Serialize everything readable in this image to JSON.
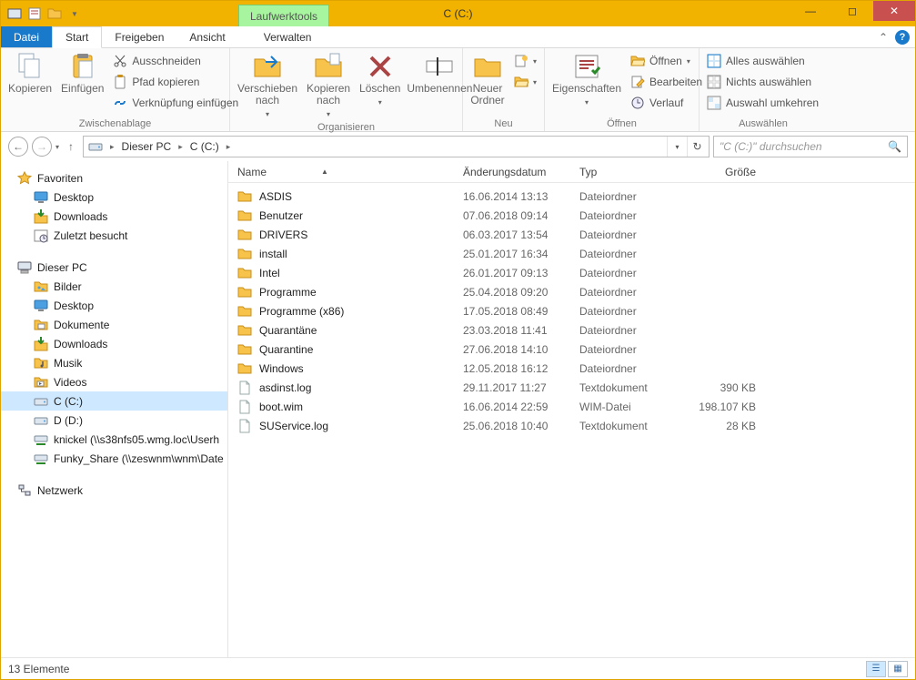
{
  "window": {
    "title": "C (C:)",
    "title_tab": "Laufwerktools"
  },
  "tabs": {
    "datei": "Datei",
    "start": "Start",
    "freigeben": "Freigeben",
    "ansicht": "Ansicht",
    "verwalten": "Verwalten"
  },
  "ribbon": {
    "zwischenablage": {
      "label": "Zwischenablage",
      "kopieren": "Kopieren",
      "einfuegen": "Einfügen",
      "ausschneiden": "Ausschneiden",
      "pfad_kopieren": "Pfad kopieren",
      "verknuepfung": "Verknüpfung einfügen"
    },
    "organisieren": {
      "label": "Organisieren",
      "verschieben": "Verschieben nach",
      "kopieren_nach": "Kopieren nach",
      "loeschen": "Löschen",
      "umbenennen": "Umbenennen"
    },
    "neu": {
      "label": "Neu",
      "neuer_ordner": "Neuer Ordner"
    },
    "oeffnen": {
      "label": "Öffnen",
      "eigenschaften": "Eigenschaften",
      "oeffnen": "Öffnen",
      "bearbeiten": "Bearbeiten",
      "verlauf": "Verlauf"
    },
    "auswaehlen": {
      "label": "Auswählen",
      "alles": "Alles auswählen",
      "nichts": "Nichts auswählen",
      "umkehren": "Auswahl umkehren"
    }
  },
  "breadcrumb": {
    "pc": "Dieser PC",
    "drive": "C (C:)"
  },
  "search_placeholder": "\"C (C:)\" durchsuchen",
  "tree": {
    "favoriten": "Favoriten",
    "fav_items": [
      "Desktop",
      "Downloads",
      "Zuletzt besucht"
    ],
    "dieser_pc": "Dieser PC",
    "pc_items": [
      "Bilder",
      "Desktop",
      "Dokumente",
      "Downloads",
      "Musik",
      "Videos",
      "C (C:)",
      "D (D:)",
      "knickel (\\\\s38nfs05.wmg.loc\\Userh",
      "Funky_Share (\\\\zeswnm\\wnm\\Date"
    ],
    "netzwerk": "Netzwerk"
  },
  "columns": {
    "name": "Name",
    "date": "Änderungsdatum",
    "type": "Typ",
    "size": "Größe"
  },
  "rows": [
    {
      "icon": "folder",
      "name": "ASDIS",
      "date": "16.06.2014 13:13",
      "type": "Dateiordner",
      "size": ""
    },
    {
      "icon": "folder",
      "name": "Benutzer",
      "date": "07.06.2018 09:14",
      "type": "Dateiordner",
      "size": ""
    },
    {
      "icon": "folder",
      "name": "DRIVERS",
      "date": "06.03.2017 13:54",
      "type": "Dateiordner",
      "size": ""
    },
    {
      "icon": "folder",
      "name": "install",
      "date": "25.01.2017 16:34",
      "type": "Dateiordner",
      "size": ""
    },
    {
      "icon": "folder",
      "name": "Intel",
      "date": "26.01.2017 09:13",
      "type": "Dateiordner",
      "size": ""
    },
    {
      "icon": "folder",
      "name": "Programme",
      "date": "25.04.2018 09:20",
      "type": "Dateiordner",
      "size": ""
    },
    {
      "icon": "folder",
      "name": "Programme (x86)",
      "date": "17.05.2018 08:49",
      "type": "Dateiordner",
      "size": ""
    },
    {
      "icon": "folder",
      "name": "Quarantäne",
      "date": "23.03.2018 11:41",
      "type": "Dateiordner",
      "size": ""
    },
    {
      "icon": "folder",
      "name": "Quarantine",
      "date": "27.06.2018 14:10",
      "type": "Dateiordner",
      "size": ""
    },
    {
      "icon": "folder",
      "name": "Windows",
      "date": "12.05.2018 16:12",
      "type": "Dateiordner",
      "size": ""
    },
    {
      "icon": "file",
      "name": "asdinst.log",
      "date": "29.11.2017 11:27",
      "type": "Textdokument",
      "size": "390 KB"
    },
    {
      "icon": "file",
      "name": "boot.wim",
      "date": "16.06.2014 22:59",
      "type": "WIM-Datei",
      "size": "198.107 KB"
    },
    {
      "icon": "file",
      "name": "SUService.log",
      "date": "25.06.2018 10:40",
      "type": "Textdokument",
      "size": "28 KB"
    }
  ],
  "status": "13 Elemente",
  "tree_icons": {
    "favoriten": "star",
    "Desktop": "desktop",
    "Downloads": "downloads",
    "Zuletzt besucht": "recent",
    "dieser_pc": "pc",
    "Bilder": "pictures",
    "Dokumente": "documents",
    "Musik": "music",
    "Videos": "videos",
    "C (C:)": "drive",
    "D (D:)": "drive",
    "netzwerk": "network",
    "net_default": "netdrive"
  }
}
